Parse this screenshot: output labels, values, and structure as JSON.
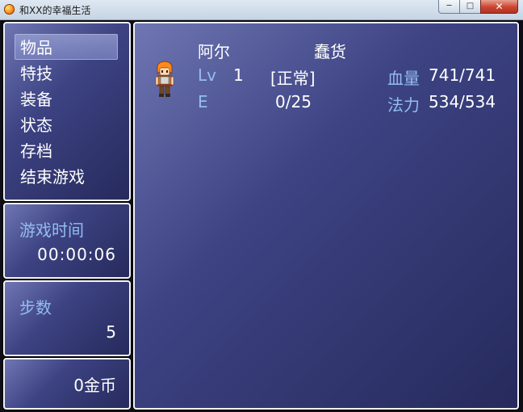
{
  "window": {
    "title": "和XX的幸福生活",
    "minimize_label": "─",
    "maximize_label": "□",
    "close_label": "✕"
  },
  "menu": {
    "items": [
      "物品",
      "特技",
      "装备",
      "状态",
      "存档",
      "结束游戏"
    ],
    "selected_index": 0
  },
  "playtime": {
    "label": "游戏时间",
    "value": "00:00:06"
  },
  "steps": {
    "label": "步数",
    "value": "5"
  },
  "gold": {
    "value": "0",
    "unit": "金币"
  },
  "party": {
    "members": [
      {
        "name": "阿尔",
        "title": "蠢货",
        "level_label": "Lv",
        "level": "1",
        "state": "[正常]",
        "exp_label": "E",
        "exp": "0/25",
        "hp_label": "血量",
        "hp": "741/741",
        "mp_label": "法力",
        "mp": "534/534",
        "sprite": "orange-haired-hero-sprite"
      }
    ]
  },
  "colors": {
    "window_gradient_light": "#6f76b3",
    "window_gradient_dark": "#262a5c",
    "system_text": "#94bdf0",
    "normal_text": "#ffffff",
    "border": "#f2f2f6"
  }
}
